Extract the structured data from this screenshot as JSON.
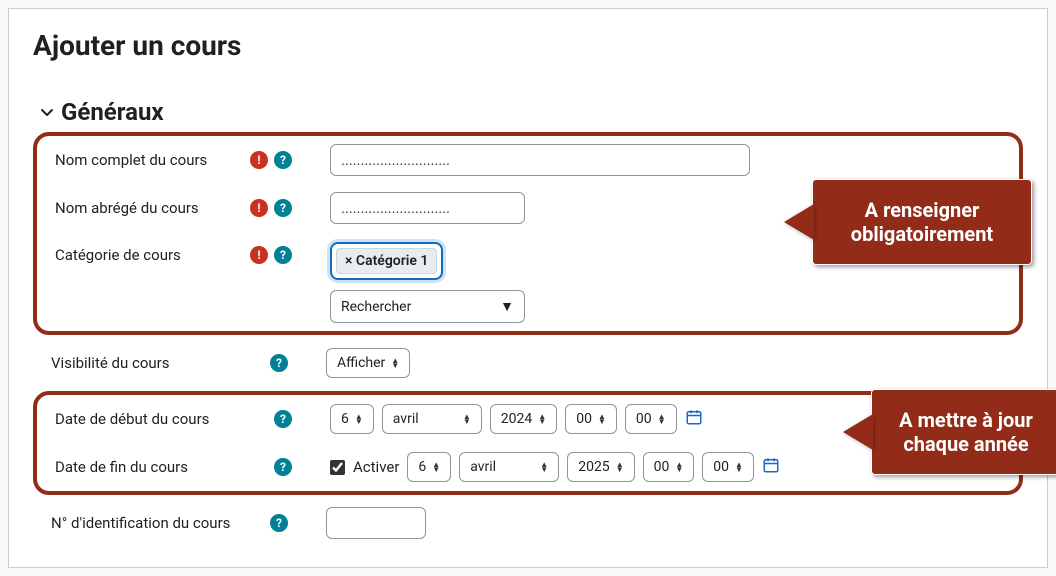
{
  "page": {
    "title": "Ajouter un cours"
  },
  "section": {
    "title": "Généraux"
  },
  "labels": {
    "fullname": "Nom complet du cours",
    "shortname": "Nom abrégé du cours",
    "category": "Catégorie de cours",
    "visibility": "Visibilité du cours",
    "startdate": "Date de début du cours",
    "enddate": "Date de fin du cours",
    "idnumber": "N° d'identification du cours",
    "activate": "Activer"
  },
  "icons": {
    "required": "!",
    "help": "?"
  },
  "fields": {
    "fullname": {
      "value": "............................"
    },
    "shortname": {
      "value": "............................"
    },
    "category": {
      "chip": "× Catégorie 1",
      "search": "Rechercher",
      "dropdown": "▼"
    },
    "visibility": {
      "value": "Afficher"
    },
    "startdate": {
      "day": "6",
      "month": "avril",
      "year": "2024",
      "hour": "00",
      "minute": "00"
    },
    "enddate": {
      "enabled": true,
      "day": "6",
      "month": "avril",
      "year": "2025",
      "hour": "00",
      "minute": "00"
    },
    "idnumber": {
      "value": ""
    }
  },
  "callouts": {
    "mandatory": "A renseigner\nobligatoirement",
    "yearly": "A mettre à jour\nchaque année"
  }
}
